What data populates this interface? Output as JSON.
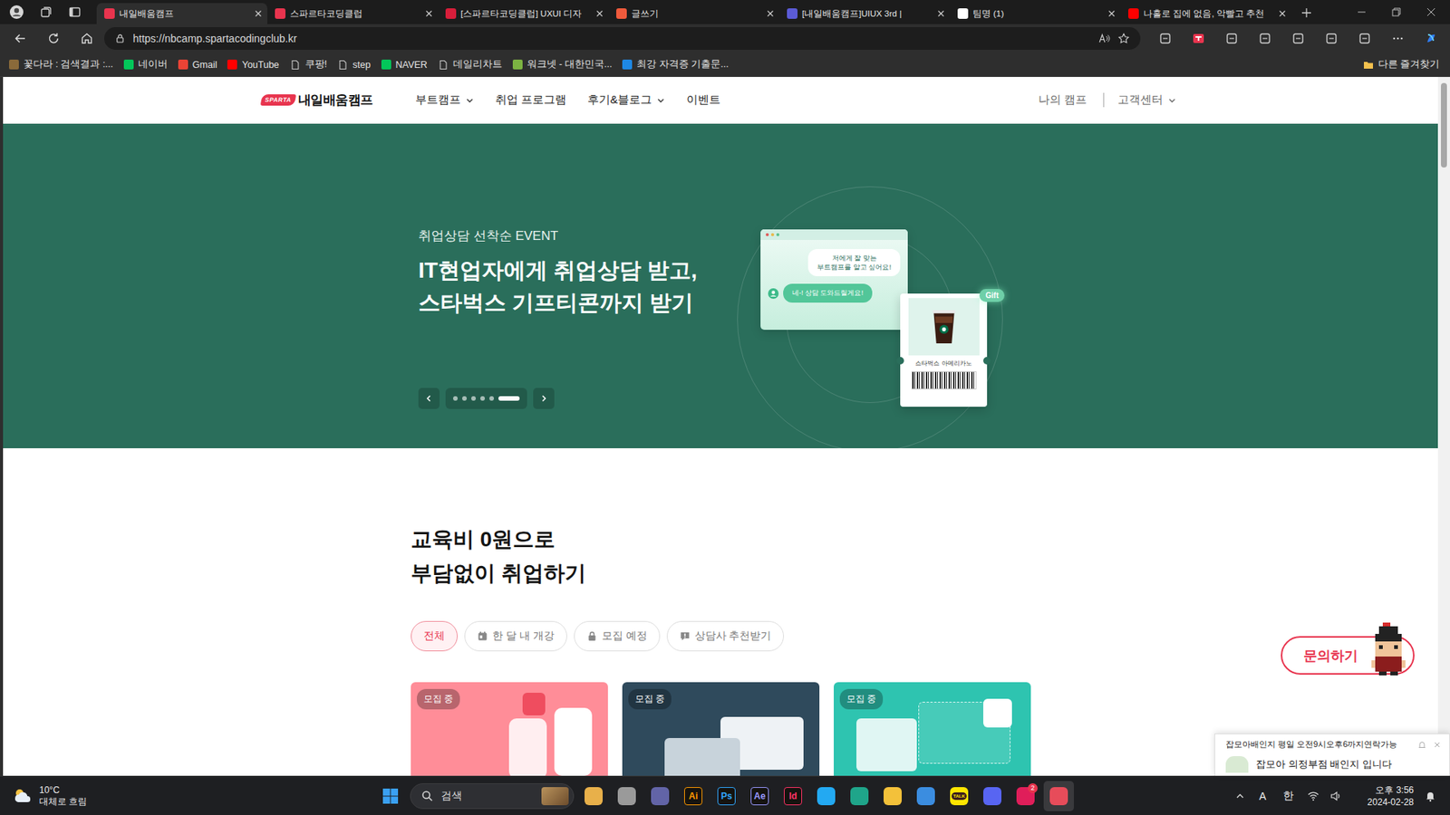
{
  "browser": {
    "tabs": [
      {
        "label": "내일배움캠프",
        "selected": true,
        "color": "#e8344e"
      },
      {
        "label": "스파르타코딩클럽",
        "selected": false,
        "color": "#e8344e"
      },
      {
        "label": "[스파르타코딩클럽] UXUI 디자",
        "selected": false,
        "color": "#d81e3a"
      },
      {
        "label": "글쓰기",
        "selected": false,
        "color": "#ef5a3c"
      },
      {
        "label": "[내일배움캠프]UIUX 3rd |",
        "selected": false,
        "color": "#5b5bd6"
      },
      {
        "label": "팀명 (1)",
        "selected": false,
        "color": "#ffffff"
      },
      {
        "label": "나홀로 집에 없음, 악빨고 추천",
        "selected": false,
        "color": "#ff0000"
      }
    ],
    "address": "https://nbcamp.spartacodingclub.kr",
    "bookmarks": [
      {
        "label": "꽃다라 : 검색결과 :...",
        "kind": "favicon",
        "color": "#8a6a3a"
      },
      {
        "label": "네이버",
        "kind": "favicon",
        "color": "#03c75a"
      },
      {
        "label": "Gmail",
        "kind": "favicon",
        "color": "#ea4335"
      },
      {
        "label": "YouTube",
        "kind": "favicon",
        "color": "#ff0000"
      },
      {
        "label": "쿠팡!",
        "kind": "page",
        "color": "#cccccc"
      },
      {
        "label": "step",
        "kind": "page",
        "color": "#cccccc"
      },
      {
        "label": "NAVER",
        "kind": "favicon",
        "color": "#03c75a"
      },
      {
        "label": "데일리차트",
        "kind": "page",
        "color": "#cccccc"
      },
      {
        "label": "워크넷 - 대한민국...",
        "kind": "favicon",
        "color": "#7cb342"
      },
      {
        "label": "최강 자격증 기출문...",
        "kind": "favicon",
        "color": "#1e88e5"
      }
    ],
    "other_bookmarks": "다른 즐겨찾기"
  },
  "site": {
    "logo": {
      "badge": "SPARTA",
      "name": "내일배움캠프"
    },
    "nav": [
      {
        "label": "부트캠프",
        "dropdown": true
      },
      {
        "label": "취업 프로그램",
        "dropdown": false
      },
      {
        "label": "후기&블로그",
        "dropdown": true
      },
      {
        "label": "이벤트",
        "dropdown": false
      }
    ],
    "nav_right": [
      {
        "label": "나의 캠프",
        "dropdown": false
      },
      {
        "label": "고객센터",
        "dropdown": true
      }
    ],
    "hero": {
      "eyebrow": "취업상담 선착순 EVENT",
      "headline": [
        "IT현업자에게 취업상담 받고,",
        "스타벅스 기프티콘까지 받기"
      ],
      "slides": [
        {
          "selected": false
        },
        {
          "selected": false
        },
        {
          "selected": false
        },
        {
          "selected": false
        },
        {
          "selected": false
        },
        {
          "selected": true
        }
      ],
      "chat": {
        "question": [
          "저에게 잘 맞는",
          "부트캠프를 알고 싶어요!"
        ],
        "answer": "네-! 상담 도와드릴게요!"
      },
      "gift": {
        "tag": "Gift",
        "item": "스타벅스 아메리카노"
      }
    },
    "section": {
      "title": [
        "교육비 0원으로",
        "부담없이 취업하기"
      ],
      "filters": [
        {
          "label": "전체",
          "selected": true
        },
        {
          "label": "한 달 내 개강",
          "selected": false
        },
        {
          "label": "모집 예정",
          "selected": false
        },
        {
          "label": "상담사 추천받기",
          "selected": false
        }
      ],
      "cards": [
        {
          "badge": "모집 중",
          "color": "#ff8d98"
        },
        {
          "badge": "모집 중",
          "color": "#2f4a5c"
        },
        {
          "badge": "모집 중",
          "color": "#2ec4b0"
        }
      ]
    },
    "inquiry": "문의하기",
    "notification": {
      "title": "잡모아배인지 평일 오전9시오후6까지연락가능",
      "body": "잡모아 의정부점 배인지 입니다"
    }
  },
  "taskbar": {
    "weather": {
      "temp": "10°C",
      "desc": "대체로 흐림"
    },
    "search": "검색",
    "apps": [
      {
        "kind": "tile",
        "label": "",
        "color": "#e8b04a",
        "badge": "",
        "selected": false
      },
      {
        "kind": "tile",
        "label": "",
        "color": "#9a9a9a",
        "badge": "",
        "selected": false
      },
      {
        "kind": "tile",
        "label": "",
        "color": "#6264a7",
        "badge": "",
        "selected": false
      },
      {
        "kind": "letter",
        "label": "Ai",
        "color": "#ff9a00",
        "badge": "",
        "selected": false
      },
      {
        "kind": "letter",
        "label": "Ps",
        "color": "#31a8ff",
        "badge": "",
        "selected": false
      },
      {
        "kind": "letter",
        "label": "Ae",
        "color": "#9999ff",
        "badge": "",
        "selected": false
      },
      {
        "kind": "letter",
        "label": "Id",
        "color": "#ff3366",
        "badge": "",
        "selected": false
      },
      {
        "kind": "tile",
        "label": "",
        "color": "#23a9f2",
        "badge": "",
        "selected": false
      },
      {
        "kind": "tile",
        "label": "",
        "color": "#1fa58a",
        "badge": "",
        "selected": false
      },
      {
        "kind": "tile",
        "label": "",
        "color": "#f3c13a",
        "badge": "",
        "selected": false
      },
      {
        "kind": "tile",
        "label": "",
        "color": "#3b8de0",
        "badge": "",
        "selected": false
      },
      {
        "kind": "bubble",
        "label": "TALK",
        "color": "#fee500",
        "badge": "",
        "selected": false
      },
      {
        "kind": "tile",
        "label": "",
        "color": "#5865f2",
        "badge": "",
        "selected": false
      },
      {
        "kind": "tile",
        "label": "",
        "color": "#e01e5a",
        "badge": "2",
        "selected": false
      },
      {
        "kind": "tile",
        "label": "",
        "color": "#e74c5a",
        "badge": "",
        "selected": true
      }
    ],
    "tray": {
      "ime_mode": "A",
      "ime_lang": "한"
    },
    "clock": {
      "time": "오후 3:56",
      "date": "2024-02-28"
    }
  }
}
